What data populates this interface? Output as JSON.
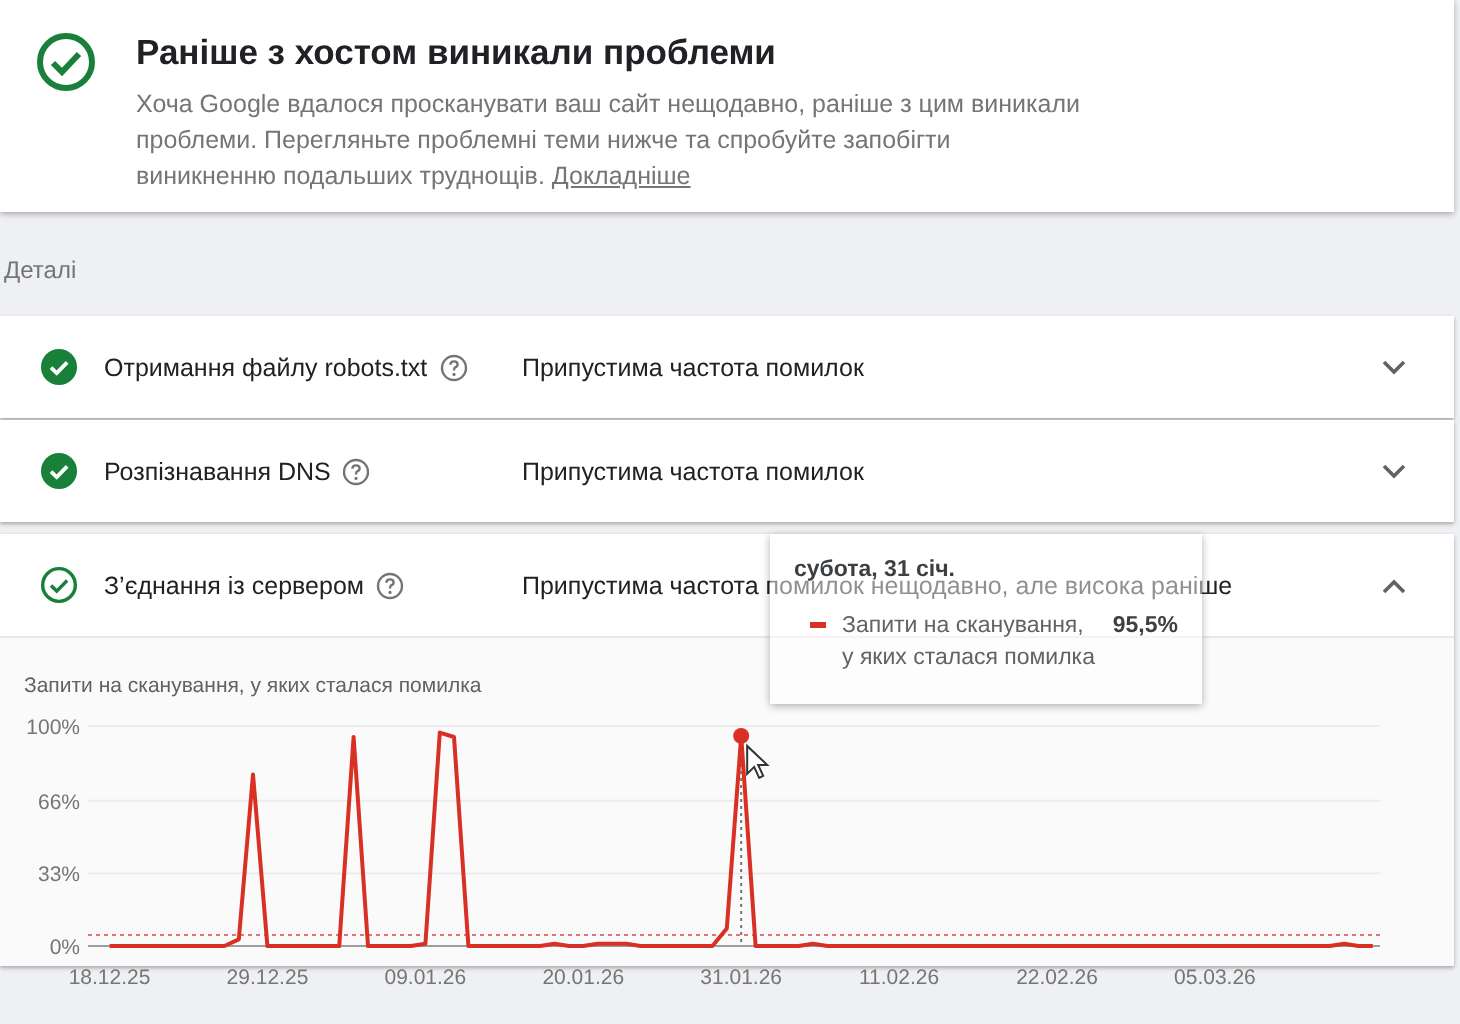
{
  "summary": {
    "title": "Раніше з хостом виникали проблеми",
    "text": "Хоча Google вдалося просканувати ваш сайт нещодавно, раніше з цим виникали проблеми. Перегляньте проблемні теми нижче та спробуйте запобігти виникненню подальших труднощів.",
    "link": "Докладніше"
  },
  "details_label": "Деталі",
  "rows": [
    {
      "name": "Отримання файлу robots.txt",
      "status": "Припустима частота помилок",
      "past_problems": false,
      "expanded": false
    },
    {
      "name": "Розпізнавання DNS",
      "status": "Припустима частота помилок",
      "past_problems": false,
      "expanded": false
    },
    {
      "name": "З’єднання із сервером",
      "status": "Припустима частота помилок нещодавно, але висока раніше",
      "past_problems": true,
      "expanded": true,
      "chart_data": {
        "type": "line",
        "title": "Запити на сканування, у яких сталася помилка",
        "categories": [
          "18.12.25",
          null,
          null,
          null,
          null,
          null,
          null,
          null,
          null,
          null,
          null,
          "29.12.25",
          null,
          null,
          null,
          null,
          null,
          null,
          null,
          null,
          null,
          null,
          "09.01.26",
          null,
          null,
          null,
          null,
          null,
          null,
          null,
          null,
          null,
          null,
          "20.01.26",
          null,
          null,
          null,
          null,
          null,
          null,
          null,
          null,
          null,
          null,
          "31.01.26",
          null,
          null,
          null,
          null,
          null,
          null,
          null,
          null,
          null,
          null,
          "11.02.26",
          null,
          null,
          null,
          null,
          null,
          null,
          null,
          null,
          null,
          null,
          "22.02.26",
          null,
          null,
          null,
          null,
          null,
          null,
          null,
          null,
          null,
          null,
          "05.03.26",
          null,
          null,
          null,
          null,
          null,
          null,
          null,
          null,
          null,
          null,
          null
        ],
        "series": [
          {
            "name": "Запити на сканування, у яких сталася помилка",
            "color": "#d93025",
            "values": [
              0,
              0,
              0,
              0,
              0,
              0,
              0,
              0,
              0,
              3,
              78,
              0,
              0,
              0,
              0,
              0,
              0,
              95,
              0,
              0,
              0,
              0,
              1,
              97,
              95,
              0,
              0,
              0,
              0,
              0,
              0,
              1,
              0,
              0,
              1,
              1,
              1,
              0,
              0,
              0,
              0,
              0,
              0,
              8,
              95.5,
              0,
              0,
              0,
              0,
              1,
              0,
              0,
              0,
              0,
              0,
              0,
              0,
              0,
              0,
              0,
              0,
              0,
              0,
              0,
              0,
              0,
              0,
              0,
              0,
              0,
              0,
              0,
              0,
              0,
              0,
              0,
              0,
              0,
              0,
              0,
              0,
              0,
              0,
              0,
              0,
              0,
              1,
              0,
              0
            ]
          }
        ],
        "ylim": [
          0,
          100
        ],
        "yticks": [
          {
            "value": 0,
            "label": "0%"
          },
          {
            "value": 33,
            "label": "33%"
          },
          {
            "value": 66,
            "label": "66%"
          },
          {
            "value": 100,
            "label": "100%"
          }
        ],
        "ref_lines": [
          {
            "axis": "y",
            "value": 5
          }
        ],
        "annotations": [
          {
            "x": "31.01.26"
          }
        ]
      },
      "tooltip": {
        "date": "субота, 31 січ.",
        "value": "95,5%"
      }
    }
  ]
}
